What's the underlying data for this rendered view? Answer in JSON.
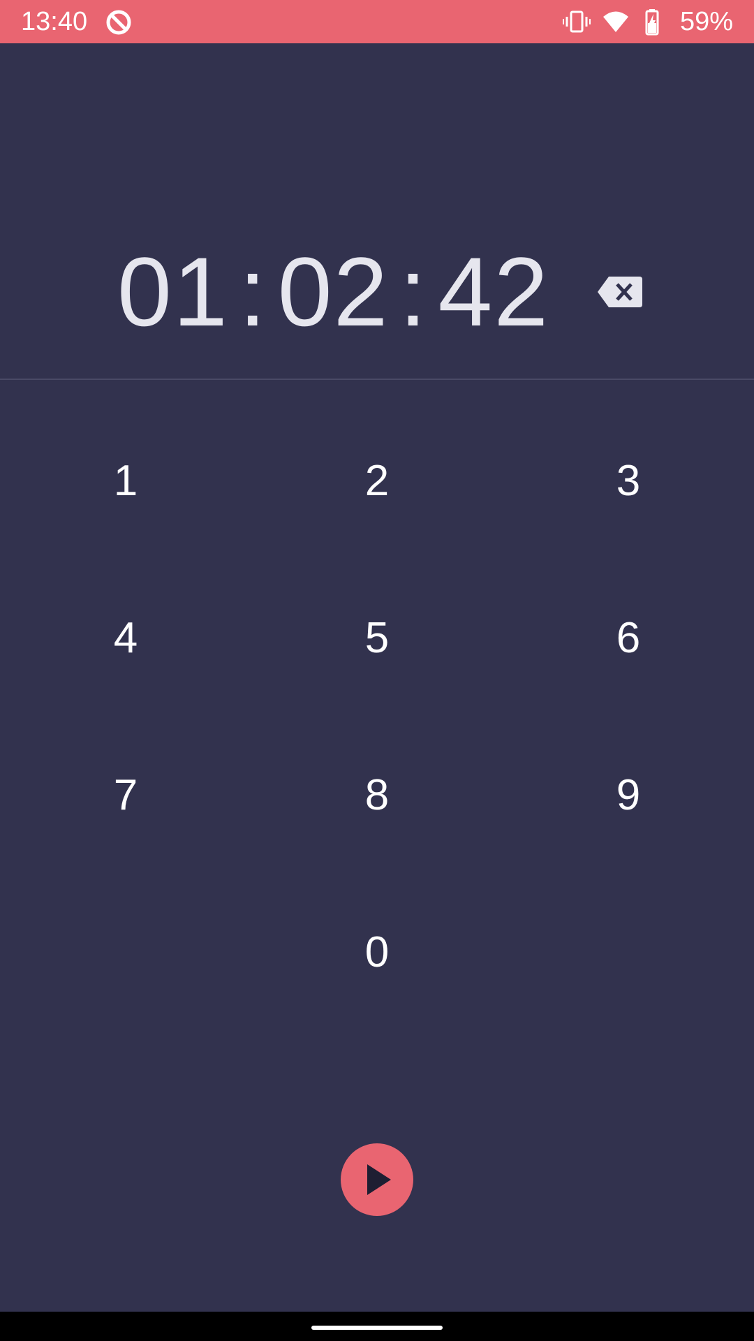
{
  "status_bar": {
    "time": "13:40",
    "battery_percent": "59%",
    "bg_color": "#e96571"
  },
  "timer": {
    "hours": "01",
    "minutes": "02",
    "seconds": "42",
    "separator": ":"
  },
  "keypad": {
    "keys": [
      "1",
      "2",
      "3",
      "4",
      "5",
      "6",
      "7",
      "8",
      "9",
      "0"
    ]
  },
  "icons": {
    "backspace": "backspace-icon",
    "start": "play-icon"
  },
  "colors": {
    "background": "#32324e",
    "accent": "#e96571",
    "divider": "#4a4a66"
  }
}
